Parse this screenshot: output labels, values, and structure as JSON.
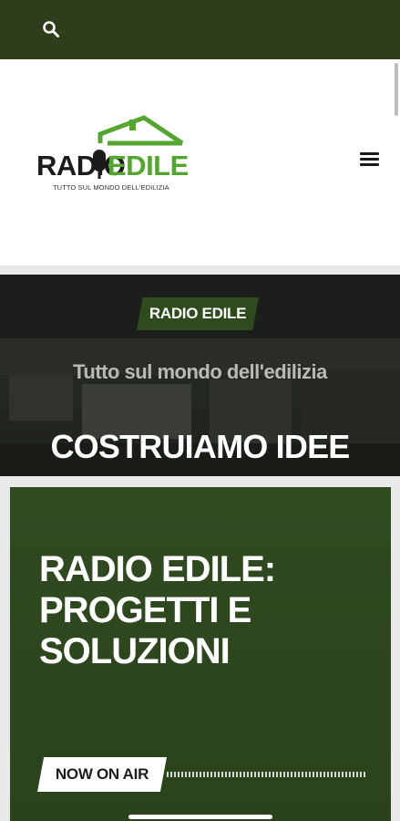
{
  "topbar": {
    "search_icon": "search-icon",
    "background": "#2e3d1c"
  },
  "logo": {
    "word_left": "RADIO",
    "word_right": "EDILE",
    "tagline": "TUTTO SUL MONDO DELL'EDILIZIA",
    "colors": {
      "dark": "#1b1b1b",
      "green": "#55a630"
    }
  },
  "menu": {
    "icon": "hamburger-menu-icon"
  },
  "hero": {
    "badge": "RADIO EDILE",
    "subtitle": "Tutto sul mondo dell'edilizia",
    "title": "COSTRUIAMO IDEE"
  },
  "card": {
    "title_lines": [
      "RADIO EDILE:",
      "PROGETTI E",
      "SOLUZIONI"
    ],
    "now_on_air": "NOW ON AIR",
    "background": "#2f4a1f"
  }
}
